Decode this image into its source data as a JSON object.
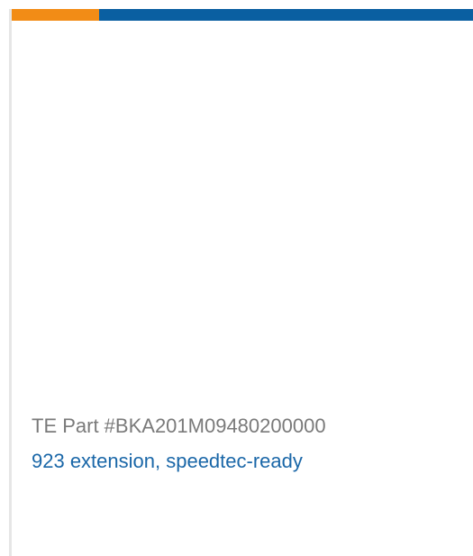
{
  "card": {
    "part_number": "TE Part #BKA201M09480200000",
    "product_name": "923 extension, speedtec-ready"
  },
  "colors": {
    "accent_orange": "#f28c16",
    "accent_blue": "#0a5fa1",
    "text_gray": "#7a7a7a",
    "link_blue": "#1a67a8",
    "border_gray": "#e6e6e6"
  }
}
